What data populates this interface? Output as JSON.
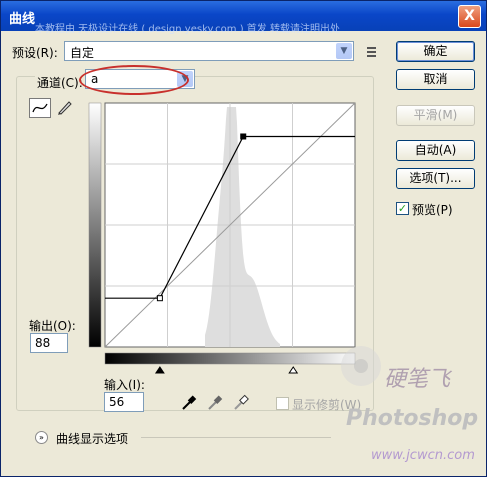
{
  "window": {
    "title": "曲线",
    "close_glyph": "X",
    "top_watermark": "本教程由 天极设计在线 ( design.yesky.com ) 首发 转载请注明出处"
  },
  "preset": {
    "label": "预设(R):",
    "value": "自定"
  },
  "channel": {
    "label": "通道(C):",
    "value": "a"
  },
  "buttons": {
    "ok": "确定",
    "cancel": "取消",
    "smooth": "平滑(M)",
    "auto": "自动(A)",
    "options": "选项(T)..."
  },
  "preview": {
    "label": "预览(P)",
    "checked": true
  },
  "output": {
    "label": "输出(O):",
    "value": "88"
  },
  "input": {
    "label": "输入(I):",
    "value": "56"
  },
  "show_clipping": {
    "label": "显示修剪(W)",
    "checked": false
  },
  "curve_display": {
    "label": "曲线显示选项"
  },
  "watermark": {
    "calligraphy": "硬笔飞",
    "brand": "Photoshop",
    "url": "www.jcwcn.com"
  },
  "curve": {
    "points": [
      [
        0,
        51
      ],
      [
        56,
        51
      ],
      [
        141,
        220
      ],
      [
        255,
        220
      ]
    ],
    "input_min": 0,
    "input_max": 255
  },
  "icons": [
    "curve-tool-icon",
    "pencil-icon",
    "black-point-eyedropper-icon",
    "gray-point-eyedropper-icon",
    "white-point-eyedropper-icon",
    "list-menu-icon",
    "expand-icon",
    "close-icon",
    "dropdown-arrow-icon"
  ]
}
